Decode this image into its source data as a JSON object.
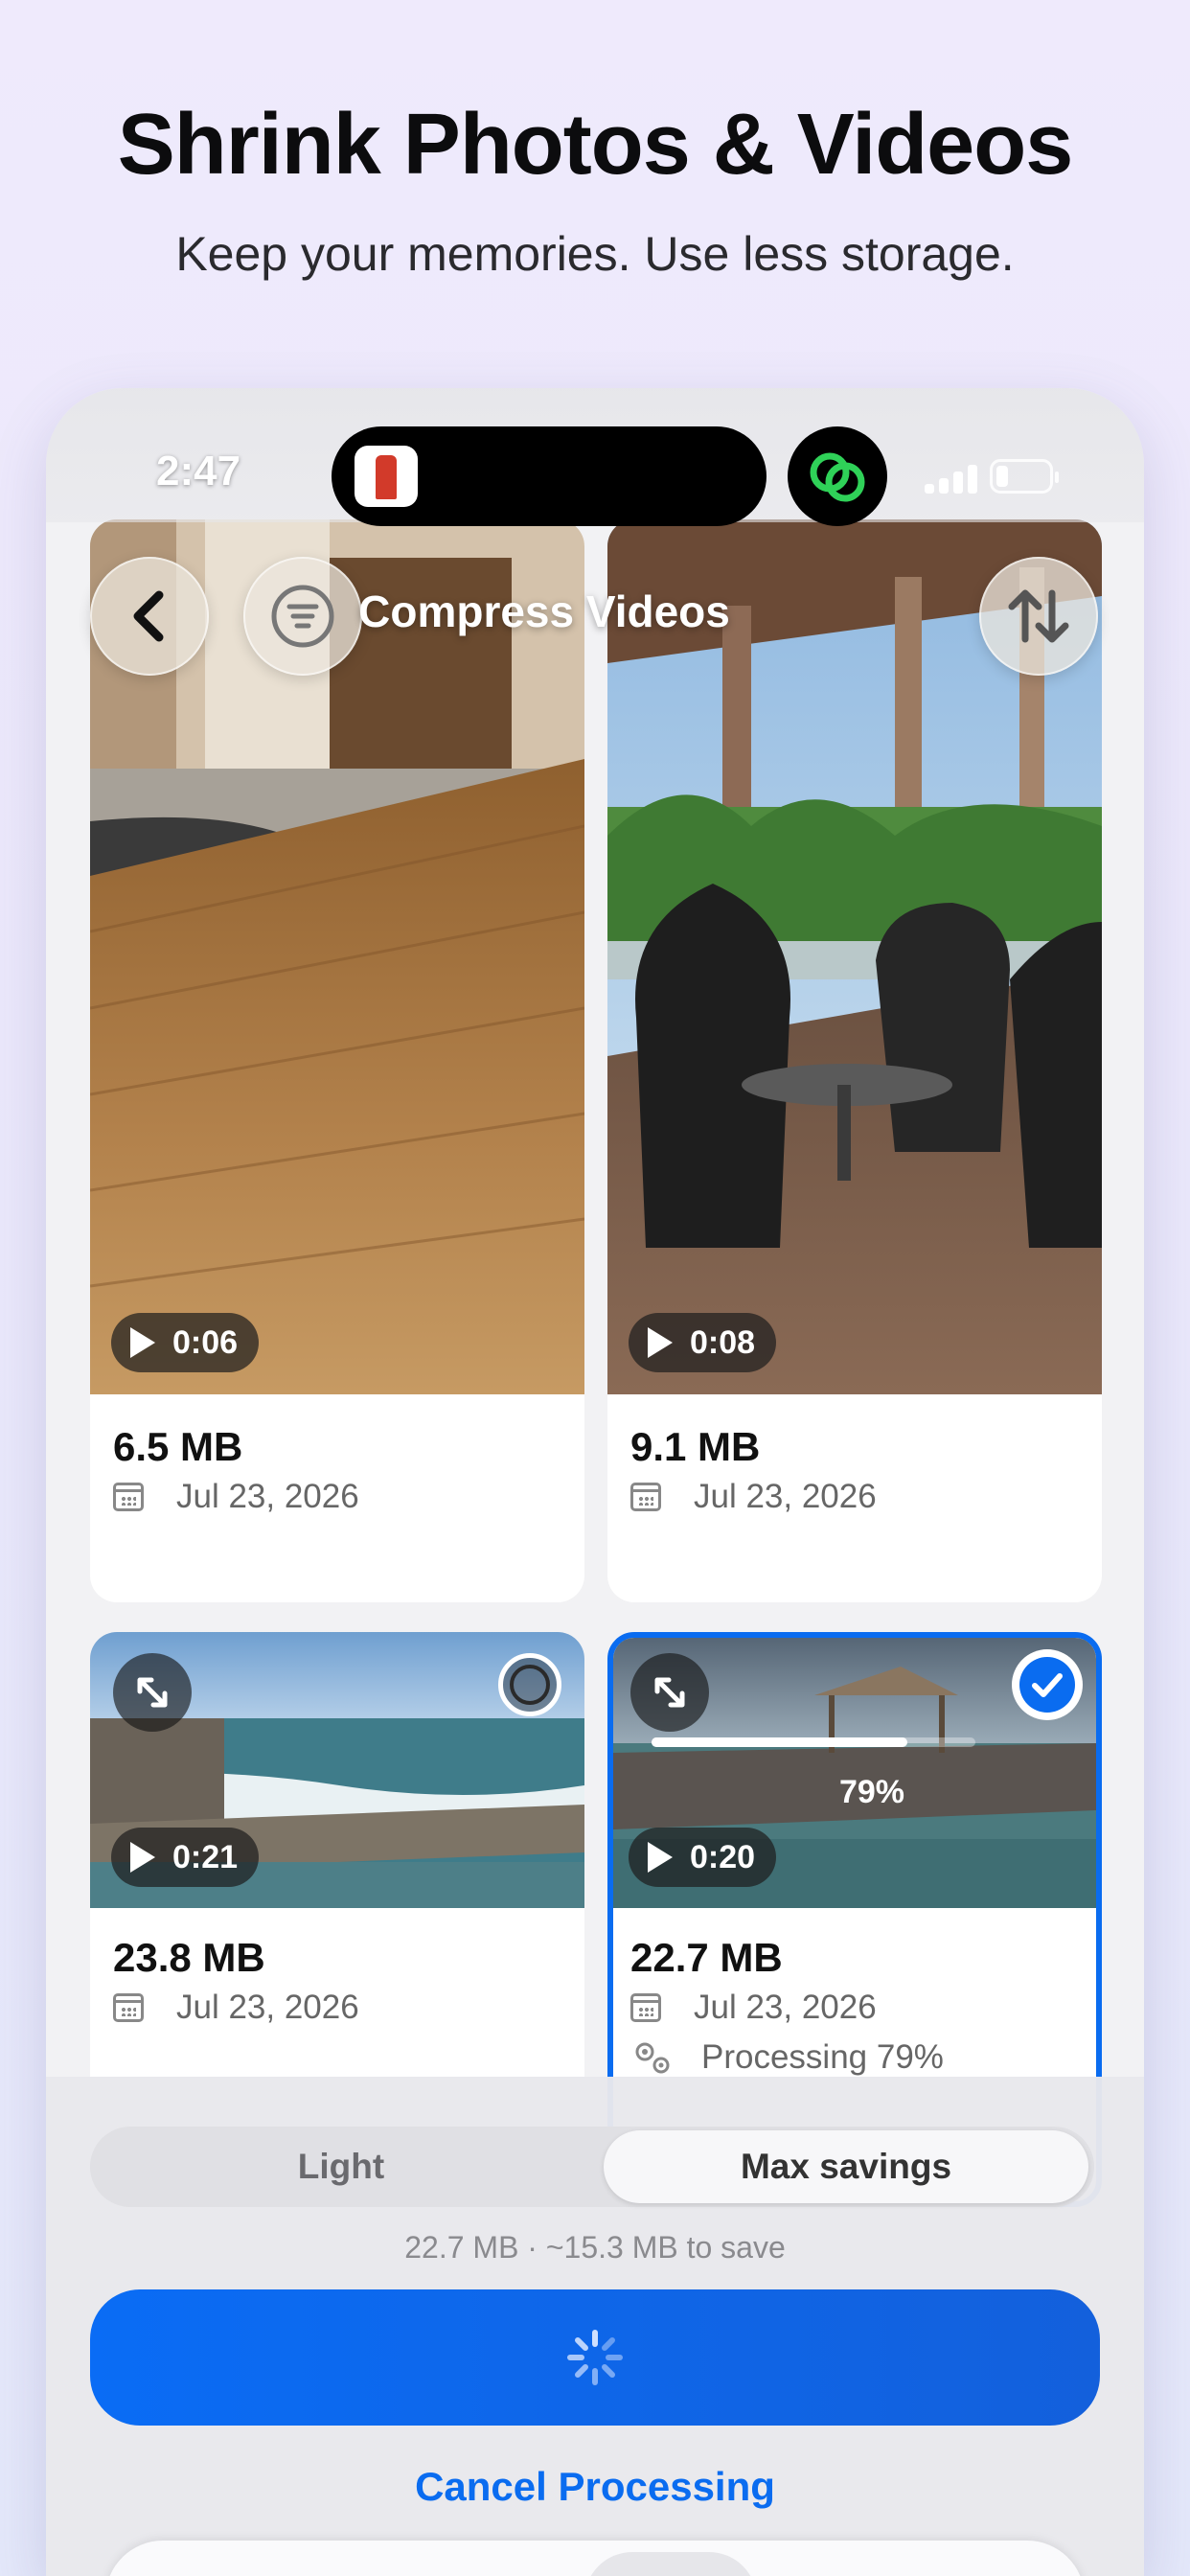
{
  "marketing": {
    "headline": "Shrink Photos & Videos",
    "subheadline": "Keep your memories. Use less storage."
  },
  "status_bar": {
    "time": "2:47"
  },
  "nav": {
    "title": "Compress Videos"
  },
  "videos": [
    {
      "duration": "0:06",
      "size": "6.5 MB",
      "date": "Jul 23, 2026",
      "selected": false
    },
    {
      "duration": "0:08",
      "size": "9.1 MB",
      "date": "Jul 23, 2026",
      "selected": false
    },
    {
      "duration": "0:21",
      "size": "23.8 MB",
      "date": "Jul 23, 2026",
      "selected": false
    },
    {
      "duration": "0:20",
      "size": "22.7 MB",
      "date": "Jul 23, 2026",
      "selected": true,
      "progress": 0.79,
      "progress_label": "79%",
      "status": "Processing 79%"
    }
  ],
  "compression": {
    "options": [
      "Light",
      "Max savings"
    ],
    "selected": "Max savings",
    "summary": "22.7 MB · ~15.3 MB to save",
    "cancel_label": "Cancel Processing"
  },
  "colors": {
    "accent": "#0a6cf0",
    "sync_badge": "#2fd158"
  }
}
